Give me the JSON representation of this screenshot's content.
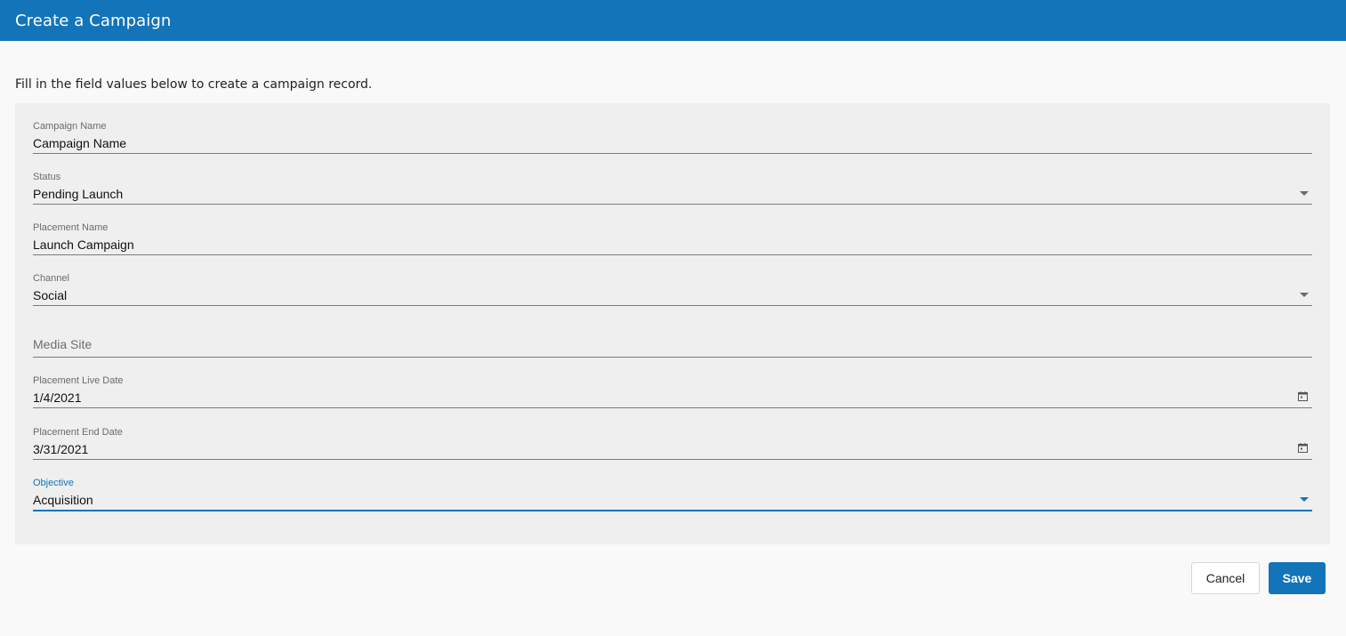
{
  "header": {
    "title": "Create a Campaign"
  },
  "intro": "Fill in the field values below to create a campaign record.",
  "fields": [
    {
      "label": "Campaign Name",
      "value": "Campaign Name",
      "type": "text"
    },
    {
      "label": "Status",
      "value": "Pending Launch",
      "type": "select"
    },
    {
      "label": "Placement Name",
      "value": "Launch Campaign",
      "type": "text"
    },
    {
      "label": "Channel",
      "value": "Social",
      "type": "select"
    },
    {
      "placeholder": "Media Site",
      "type": "text"
    },
    {
      "label": "Placement Live Date",
      "value": "1/4/2021",
      "type": "date"
    },
    {
      "label": "Placement End Date",
      "value": "3/31/2021",
      "type": "date"
    },
    {
      "label": "Objective",
      "value": "Acquisition",
      "type": "select",
      "focused": true
    }
  ],
  "icons": {
    "dropdown": "chevron-down-icon",
    "calendar": "calendar-icon"
  },
  "buttons": {
    "cancel_label": "Cancel",
    "save_label": "Save"
  },
  "colors": {
    "accent": "#1374b9",
    "panel": "#efefef",
    "background": "#f9f9f9"
  }
}
